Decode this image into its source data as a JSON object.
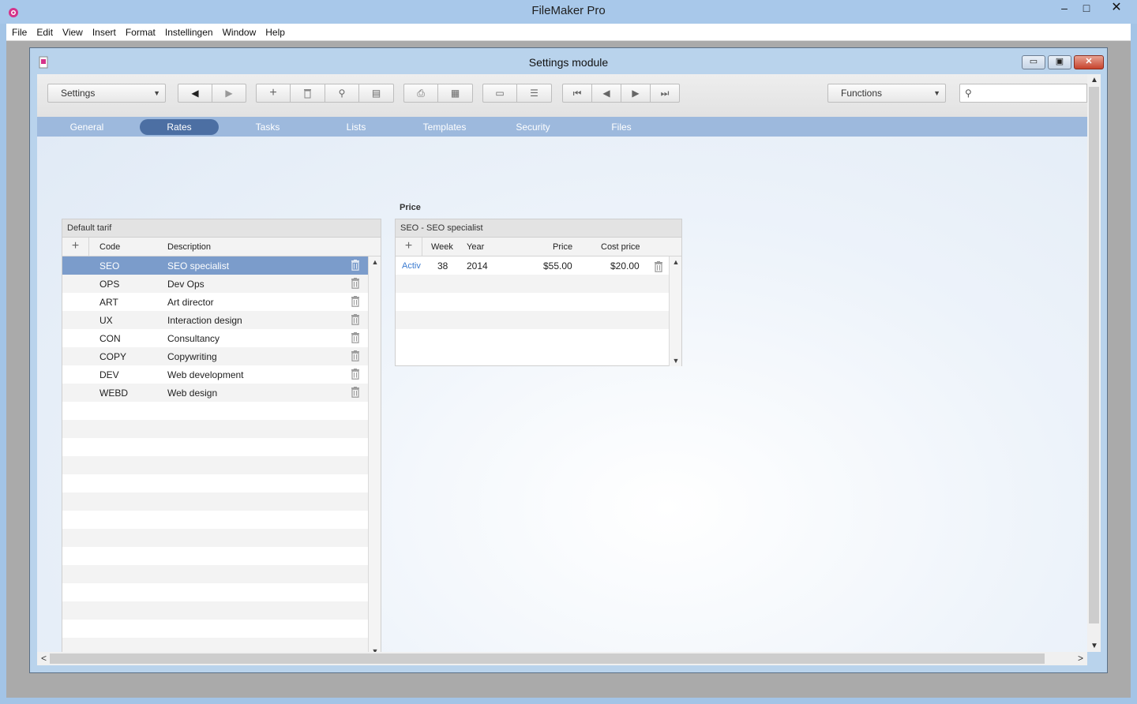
{
  "app": {
    "title": "FileMaker Pro",
    "controls": {
      "minimize": "–",
      "maximize": "□",
      "close": "✕"
    }
  },
  "menu": [
    "File",
    "Edit",
    "View",
    "Insert",
    "Format",
    "Instellingen",
    "Window",
    "Help"
  ],
  "doc": {
    "title": "Settings module",
    "controls": {
      "minimize": "▭",
      "maximize": "▣",
      "close": "✕"
    }
  },
  "toolbar": {
    "layout_select": "Settings",
    "functions_select": "Functions",
    "search_placeholder": "",
    "icons": {
      "back": "◀",
      "forward": "▶",
      "add": "+",
      "delete": "🗑",
      "find": "⚲",
      "cards": "▤",
      "print": "⎙",
      "export": "▦",
      "form_view": "▭",
      "list_view": "☰",
      "first": "⏮",
      "prev": "◀",
      "next": "▶",
      "last": "⏭",
      "search": "⚲"
    }
  },
  "tabs": [
    {
      "label": "General",
      "active": false
    },
    {
      "label": "Rates",
      "active": true
    },
    {
      "label": "Tasks",
      "active": false
    },
    {
      "label": "Lists",
      "active": false
    },
    {
      "label": "Templates",
      "active": false
    },
    {
      "label": "Security",
      "active": false
    },
    {
      "label": "Files",
      "active": false
    }
  ],
  "tariff": {
    "title": "Default tarif",
    "columns": {
      "add": "+",
      "code": "Code",
      "description": "Description"
    },
    "rows": [
      {
        "code": "SEO",
        "description": "SEO specialist",
        "selected": true
      },
      {
        "code": "OPS",
        "description": "Dev Ops",
        "selected": false
      },
      {
        "code": "ART",
        "description": "Art director",
        "selected": false
      },
      {
        "code": "UX",
        "description": "Interaction design",
        "selected": false
      },
      {
        "code": "CON",
        "description": "Consultancy",
        "selected": false
      },
      {
        "code": "COPY",
        "description": "Copywriting",
        "selected": false
      },
      {
        "code": "DEV",
        "description": "Web development",
        "selected": false
      },
      {
        "code": "WEBD",
        "description": "Web design",
        "selected": false
      }
    ],
    "blank_rows": 14
  },
  "price": {
    "section_label": "Price",
    "title": "SEO -  SEO specialist",
    "columns": {
      "add": "+",
      "week": "Week",
      "year": "Year",
      "price": "Price",
      "cost_price": "Cost price"
    },
    "rows": [
      {
        "status": "Activ",
        "week": "38",
        "year": "2014",
        "price": "$55.00",
        "cost_price": "$20.00"
      }
    ],
    "blank_rows": 4
  },
  "scroll": {
    "up": "▲",
    "down": "▼",
    "left": "<",
    "right": ">"
  }
}
